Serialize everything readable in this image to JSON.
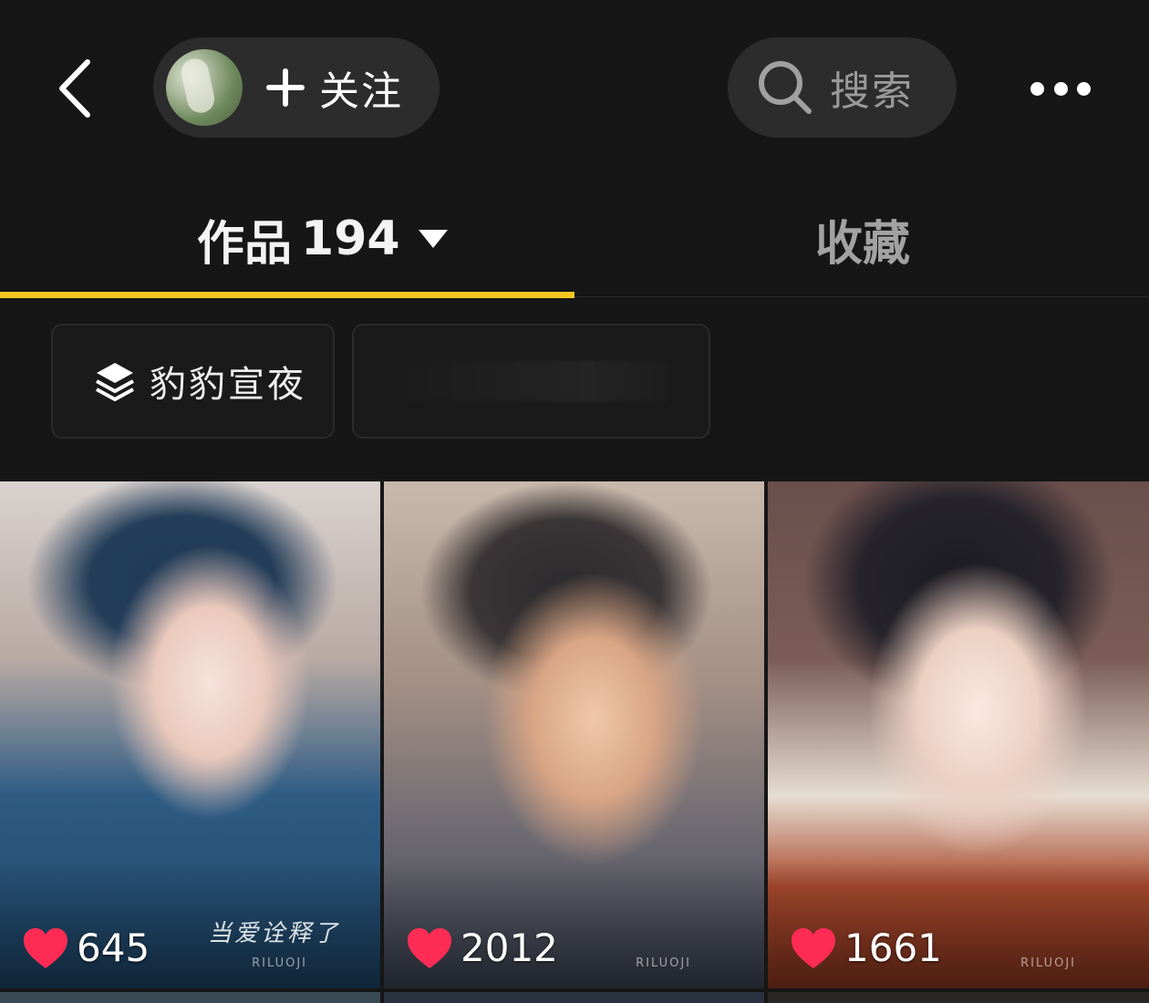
{
  "header": {
    "follow_label": "关注",
    "search_label": "搜索"
  },
  "tabs": {
    "works_label": "作品",
    "works_count": "194",
    "favorites_label": "收藏",
    "active": "works"
  },
  "collections": [
    {
      "label": "豹豹宣夜"
    }
  ],
  "videos": [
    {
      "likes": "645",
      "overlay_text": "当爱诠释了",
      "watermark": "RILUOJI"
    },
    {
      "likes": "2012",
      "watermark": "RILUOJI"
    },
    {
      "likes": "1661",
      "watermark": "RILUOJI"
    }
  ],
  "colors": {
    "background": "#161616",
    "accent_underline": "#f5c41f",
    "heart": "#fe2c55",
    "pill": "#2c2c2c"
  },
  "icons": [
    "back-icon",
    "plus-icon",
    "search-icon",
    "more-icon",
    "caret-down-icon",
    "layers-icon",
    "heart-icon"
  ]
}
